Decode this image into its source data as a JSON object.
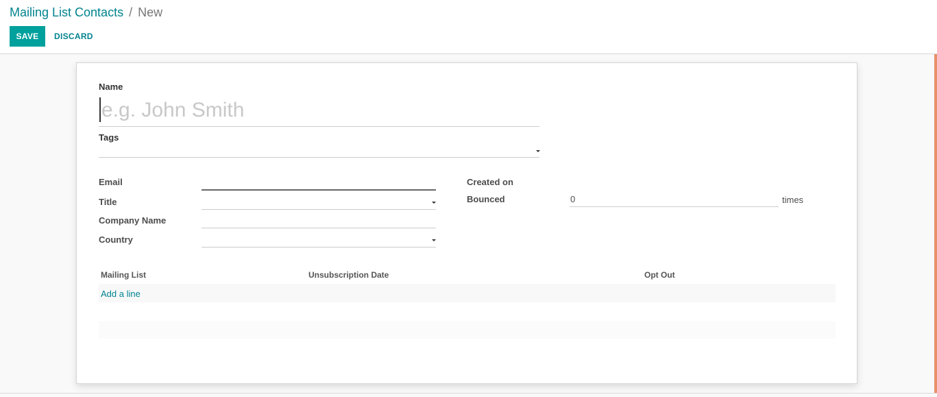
{
  "breadcrumb": {
    "parent": "Mailing List Contacts",
    "separator": "/",
    "current": "New"
  },
  "toolbar": {
    "save_label": "SAVE",
    "discard_label": "DISCARD"
  },
  "form": {
    "name_label": "Name",
    "name_placeholder": "e.g. John Smith",
    "tags_label": "Tags",
    "email_label": "Email",
    "title_label": "Title",
    "company_label": "Company Name",
    "country_label": "Country",
    "created_on_label": "Created on",
    "bounced_label": "Bounced",
    "bounced_value": "0",
    "bounced_unit": "times"
  },
  "table": {
    "headers": [
      "Mailing List",
      "Unsubscription Date",
      "Opt Out"
    ],
    "add_line": "Add a line"
  },
  "colors": {
    "primary": "#00a09d",
    "link": "#00838f",
    "scroll_accent": "#e8906a"
  }
}
